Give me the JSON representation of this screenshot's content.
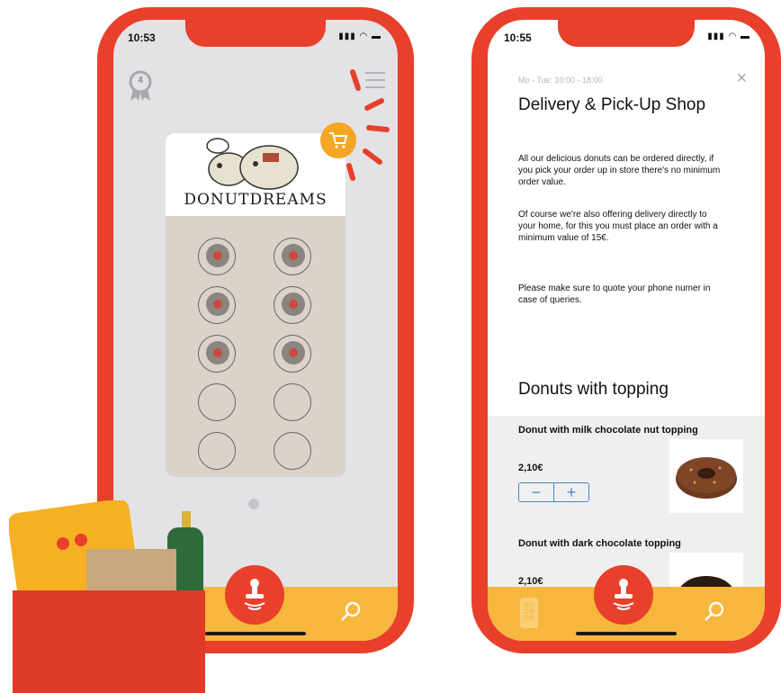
{
  "left_phone": {
    "status_time": "10:53",
    "status_icons": "▮▮▮ ◠ ▬",
    "badge_count": "4",
    "logo_text": "DONUTDREAMS",
    "stamp_total": 10,
    "stamp_filled": 6
  },
  "right_phone": {
    "status_time": "10:55",
    "status_icons": "▮▮▮ ◠ ▬",
    "hours": "Mo - Tue: 10:00 - 18:00",
    "close_glyph": "×",
    "shop_title": "Delivery & Pick-Up Shop",
    "paragraphs": [
      "All our delicious donuts can be ordered directly, if you pick your order up in store there's no minimum order value.",
      "Of course we're also offering delivery directly to your home, for this you must place an order with a minimum value of 15€.",
      "Please make sure to quote your phone numer in case of queries."
    ],
    "section_title": "Donuts with topping",
    "products": [
      {
        "name": "Donut with milk chocolate nut topping",
        "price": "2,10€"
      },
      {
        "name": "Donut with dark chocolate topping",
        "price": "2,10€"
      }
    ],
    "qty_minus": "−",
    "qty_plus": "+"
  },
  "colors": {
    "brand_red": "#e8402b",
    "tab_yellow": "#f6b73c",
    "cart_orange": "#f5a623",
    "accent_blue": "#3d8bd7"
  }
}
